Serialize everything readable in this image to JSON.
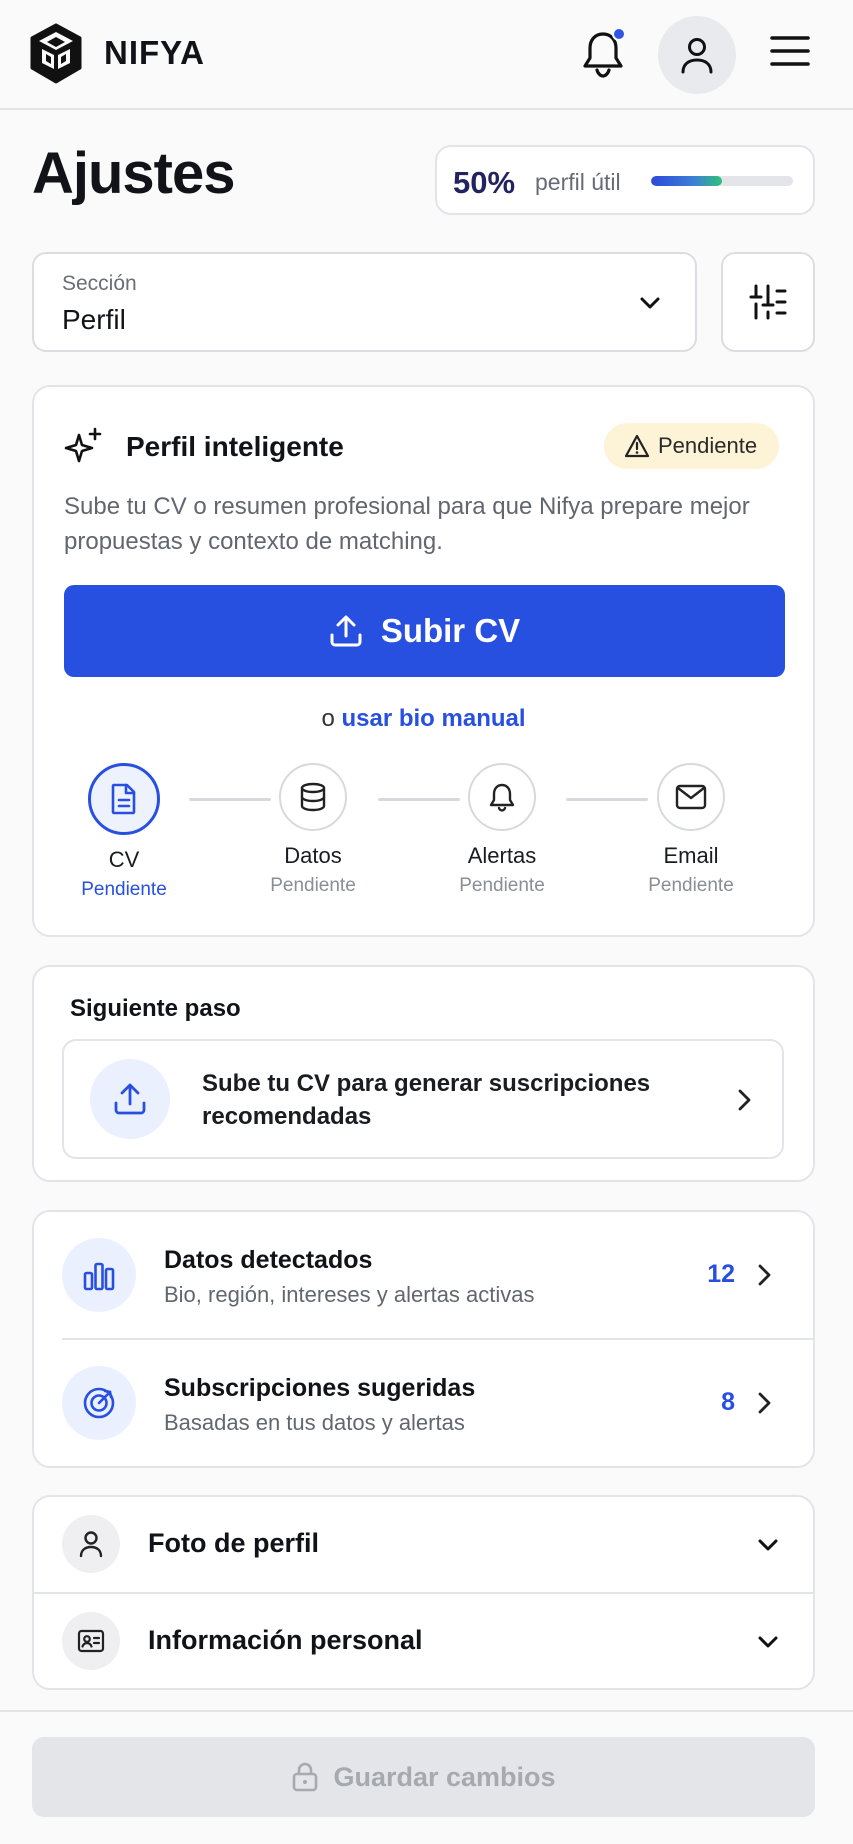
{
  "app": {
    "brand": "NIFYA"
  },
  "page": {
    "title": "Ajustes"
  },
  "progress": {
    "percent_label": "50%",
    "label": "perfil útil",
    "fraction": 0.5
  },
  "section_select": {
    "label": "Sección",
    "value": "Perfil"
  },
  "smart_profile": {
    "title": "Perfil inteligente",
    "status_badge": "Pendiente",
    "description": "Sube tu CV o resumen profesional para que Nifya prepare mejor propuestas y contexto de matching.",
    "upload_button": "Subir CV",
    "manual_prefix": "o",
    "manual_link": "usar bio manual",
    "steps": [
      {
        "title": "CV",
        "status": "Pendiente",
        "icon": "document-icon"
      },
      {
        "title": "Datos",
        "status": "Pendiente",
        "icon": "database-icon"
      },
      {
        "title": "Alertas",
        "status": "Pendiente",
        "icon": "bell-icon"
      },
      {
        "title": "Email",
        "status": "Pendiente",
        "icon": "mail-icon"
      }
    ]
  },
  "next_step": {
    "title": "Siguiente paso",
    "item_text": "Sube tu CV para generar suscripciones recomendadas"
  },
  "data_rows": [
    {
      "title": "Datos detectados",
      "subtitle": "Bio, región, intereses y alertas activas",
      "count": "12",
      "icon": "bar-chart-icon"
    },
    {
      "title": "Subscripciones sugeridas",
      "subtitle": "Basadas en tus datos y alertas",
      "count": "8",
      "icon": "target-icon"
    }
  ],
  "accordions": [
    {
      "title": "Foto de perfil",
      "icon": "user-icon"
    },
    {
      "title": "Información personal",
      "icon": "id-card-icon"
    }
  ],
  "footer": {
    "save_label": "Guardar cambios"
  },
  "colors": {
    "accent": "#2850e0",
    "badge_bg": "#fdf3d6",
    "text": "#111318",
    "muted": "#62666f"
  }
}
